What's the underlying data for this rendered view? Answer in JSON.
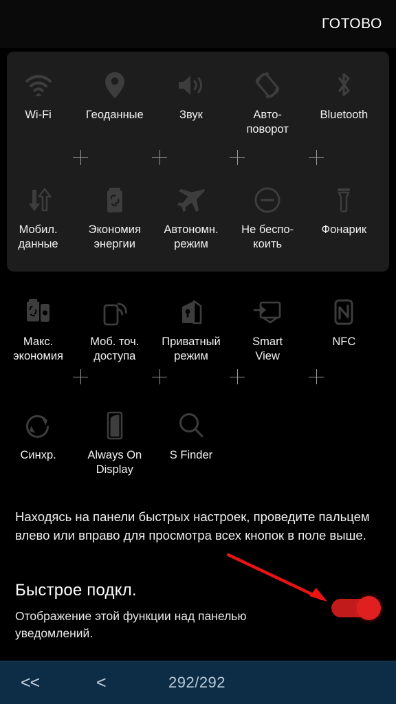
{
  "header": {
    "done_label": "ГОТОВО"
  },
  "quick_settings": {
    "rows": [
      {
        "id": "row-active-1",
        "panel": "active",
        "cells": [
          {
            "label": "Wi-Fi",
            "icon": "wifi-icon"
          },
          {
            "label": "Геоданные",
            "icon": "location-pin-icon"
          },
          {
            "label": "Звук",
            "icon": "sound-speaker-icon"
          },
          {
            "label": "Авто-\nповорот",
            "icon": "auto-rotate-icon"
          },
          {
            "label": "Bluetooth",
            "icon": "bluetooth-icon"
          }
        ]
      },
      {
        "id": "row-active-2",
        "panel": "active",
        "cells": [
          {
            "label": "Мобил.\nданные",
            "icon": "mobile-data-icon"
          },
          {
            "label": "Экономия\nэнергии",
            "icon": "power-saving-icon"
          },
          {
            "label": "Автономн.\nрежим",
            "icon": "airplane-icon"
          },
          {
            "label": "Не беспо-\nкоить",
            "icon": "do-not-disturb-icon"
          },
          {
            "label": "Фонарик",
            "icon": "flashlight-icon"
          }
        ]
      },
      {
        "id": "row-inactive-1",
        "panel": "inactive",
        "cells": [
          {
            "label": "Макс.\nэкономия",
            "icon": "max-power-saving-icon"
          },
          {
            "label": "Моб. точ.\nдоступа",
            "icon": "mobile-hotspot-icon"
          },
          {
            "label": "Приватный\nрежим",
            "icon": "private-mode-icon"
          },
          {
            "label": "Smart\nView",
            "icon": "smart-view-icon"
          },
          {
            "label": "NFC",
            "icon": "nfc-icon"
          }
        ]
      },
      {
        "id": "row-inactive-2",
        "panel": "inactive",
        "cells": [
          {
            "label": "Синхр.",
            "icon": "sync-icon"
          },
          {
            "label": "Always On\nDisplay",
            "icon": "always-on-display-icon"
          },
          {
            "label": "S Finder",
            "icon": "search-icon"
          }
        ]
      }
    ],
    "separator_symbol": "+"
  },
  "hint": {
    "text": "Находясь на панели быстрых настроек, проведите пальцем влево или вправо для просмотра всех кнопок в поле выше."
  },
  "quick_connect": {
    "title": "Быстрое подкл.",
    "description": "Отображение этой функции над панелью уведомлений.",
    "toggle_state": "on",
    "toggle_color": "#e02020"
  },
  "annotation": {
    "arrow_color": "#e81414",
    "highlight_color": "#e02020"
  },
  "bottom_bar": {
    "first_label": "<<",
    "prev_label": "<",
    "page_counter": "292/292",
    "background_color": "#0d2d46"
  }
}
